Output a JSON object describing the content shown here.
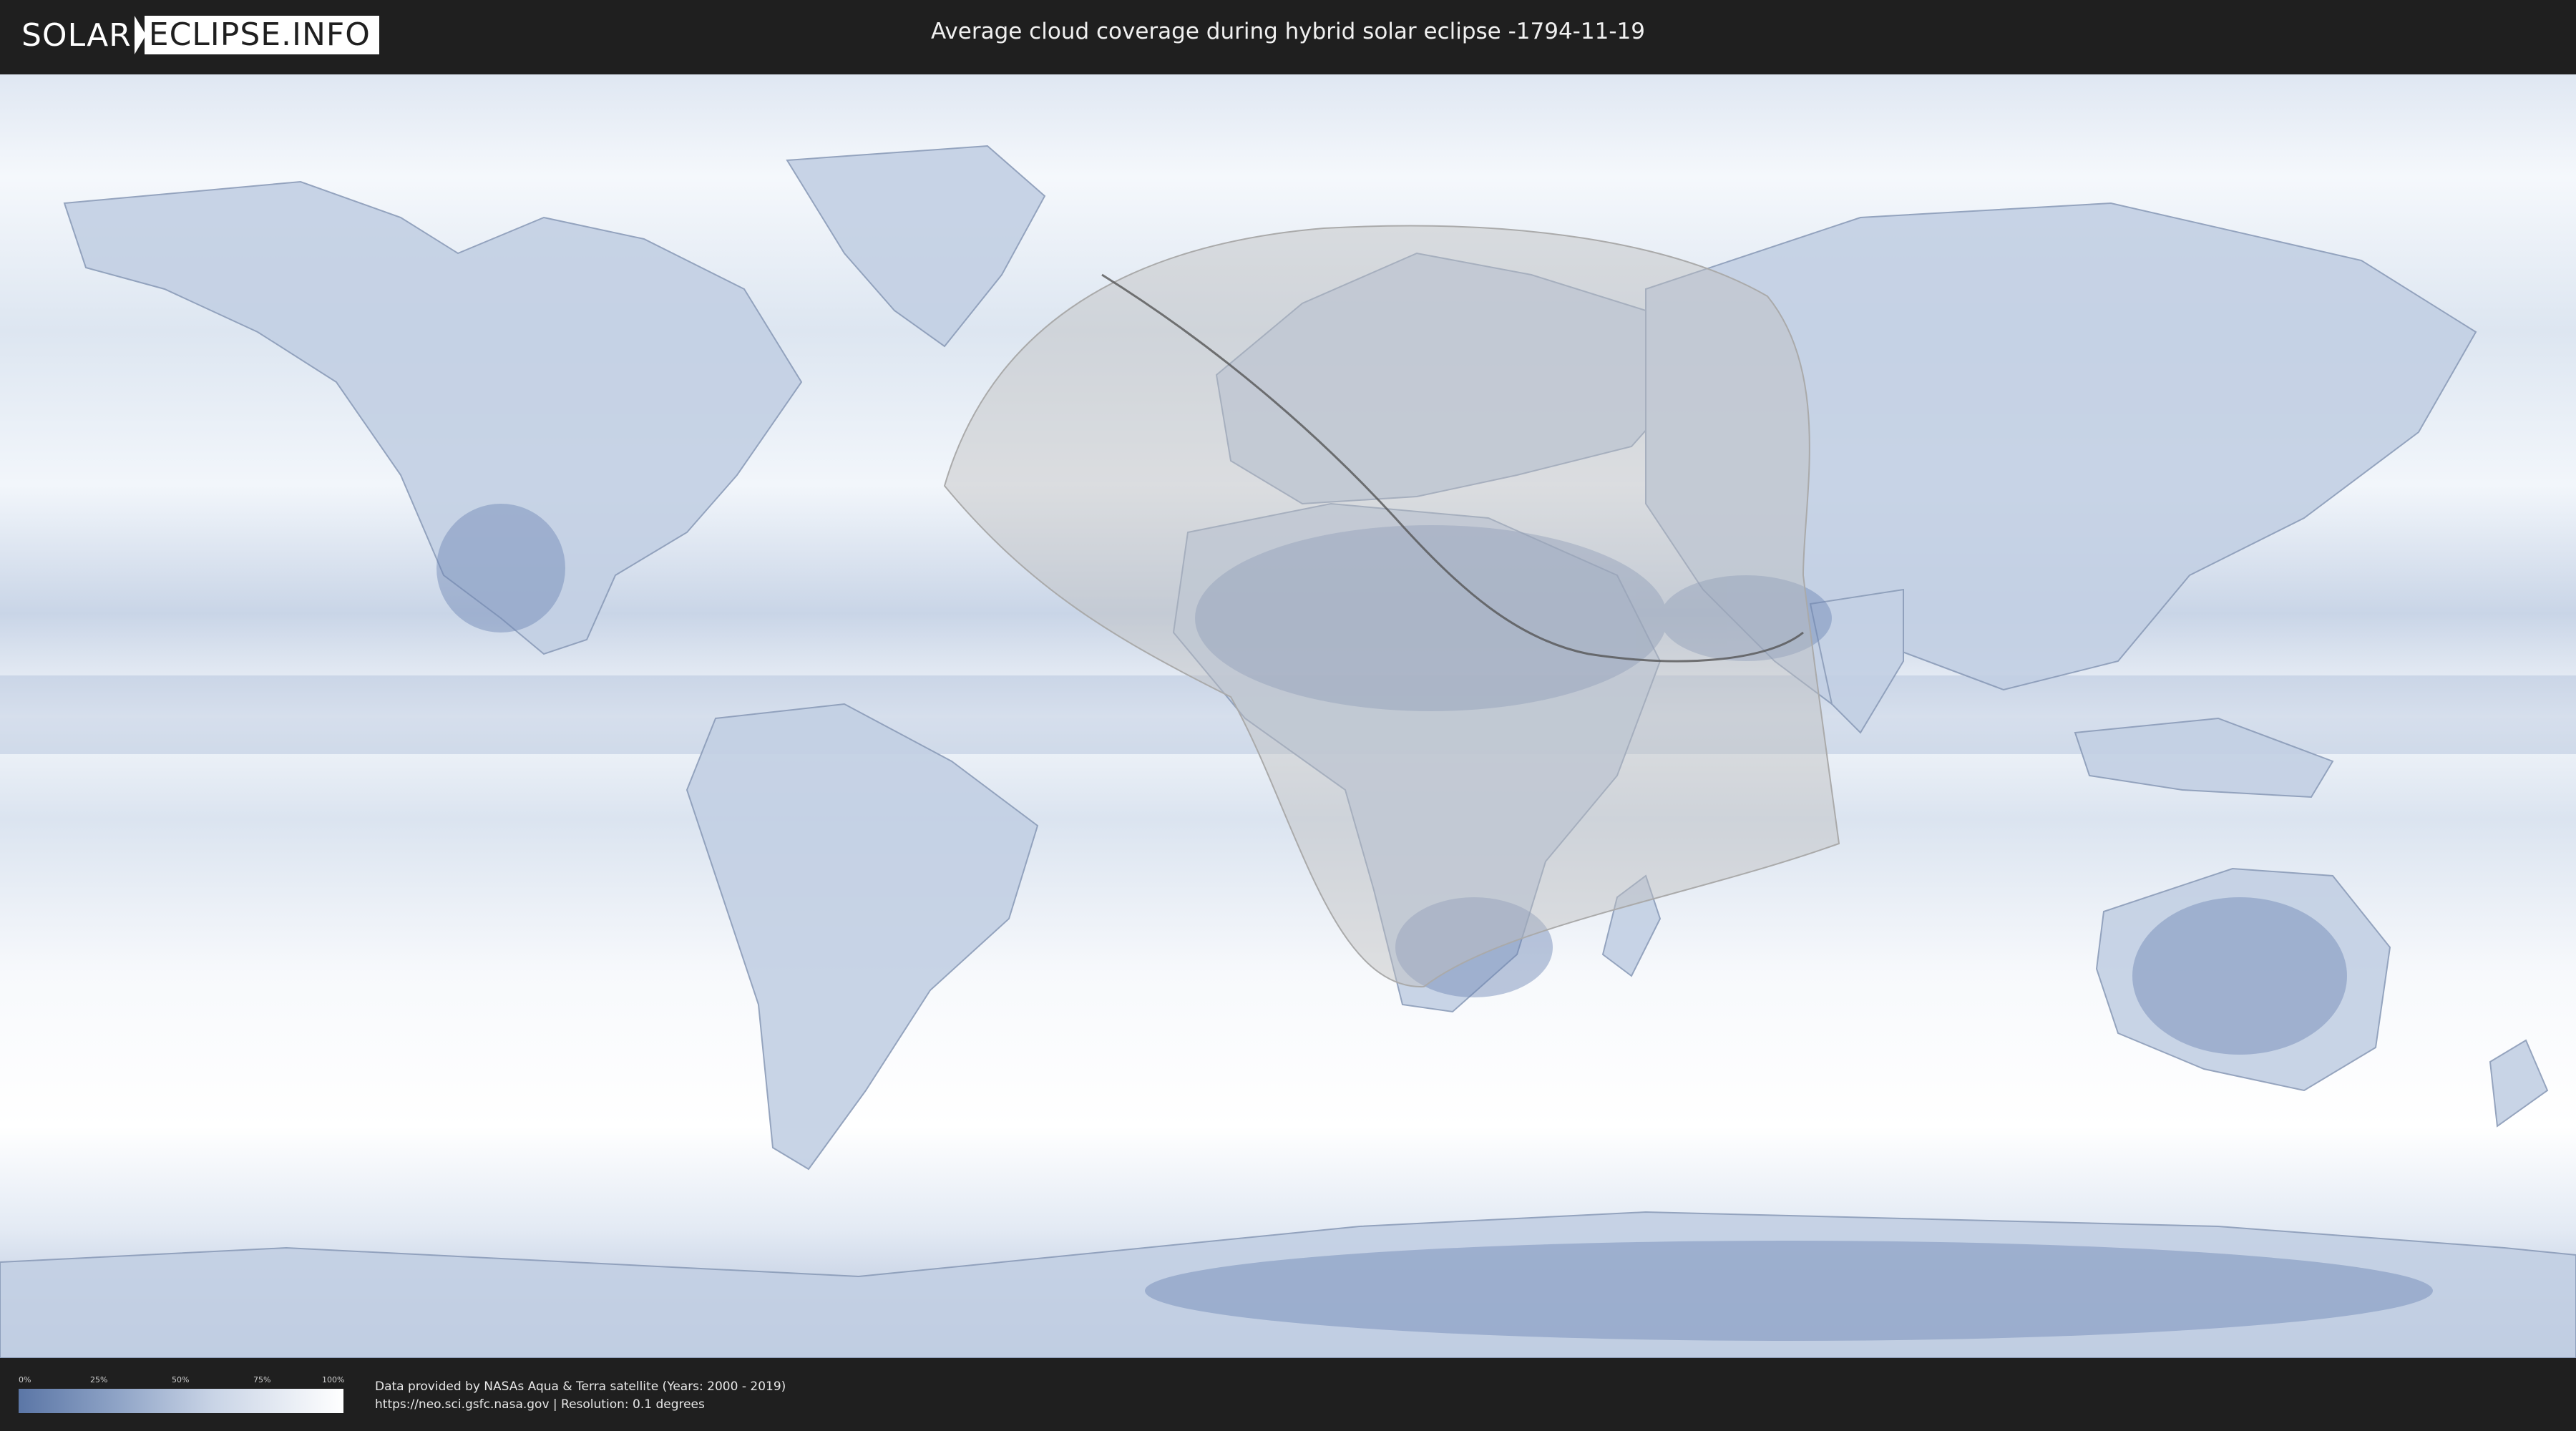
{
  "header": {
    "logo_part1": "SOLAR",
    "logo_part2": "ECLIPSE.INFO",
    "title": "Average cloud coverage during hybrid solar eclipse -1794-11-19"
  },
  "map": {
    "ocean_color": "#e6edf6",
    "cloud_color": "#ffffff",
    "low_cloud_color": "#6d86b3",
    "visibility_region_color": "#bfbfbf"
  },
  "legend": {
    "ticks": [
      "0%",
      "25%",
      "50%",
      "75%",
      "100%"
    ],
    "gradient_start": "#5b76a6",
    "gradient_end": "#ffffff"
  },
  "footer": {
    "credit_line1": "Data provided by NASAs Aqua & Terra satellite (Years: 2000 - 2019)",
    "credit_line2": "https://neo.sci.gsfc.nasa.gov | Resolution: 0.1 degrees"
  }
}
